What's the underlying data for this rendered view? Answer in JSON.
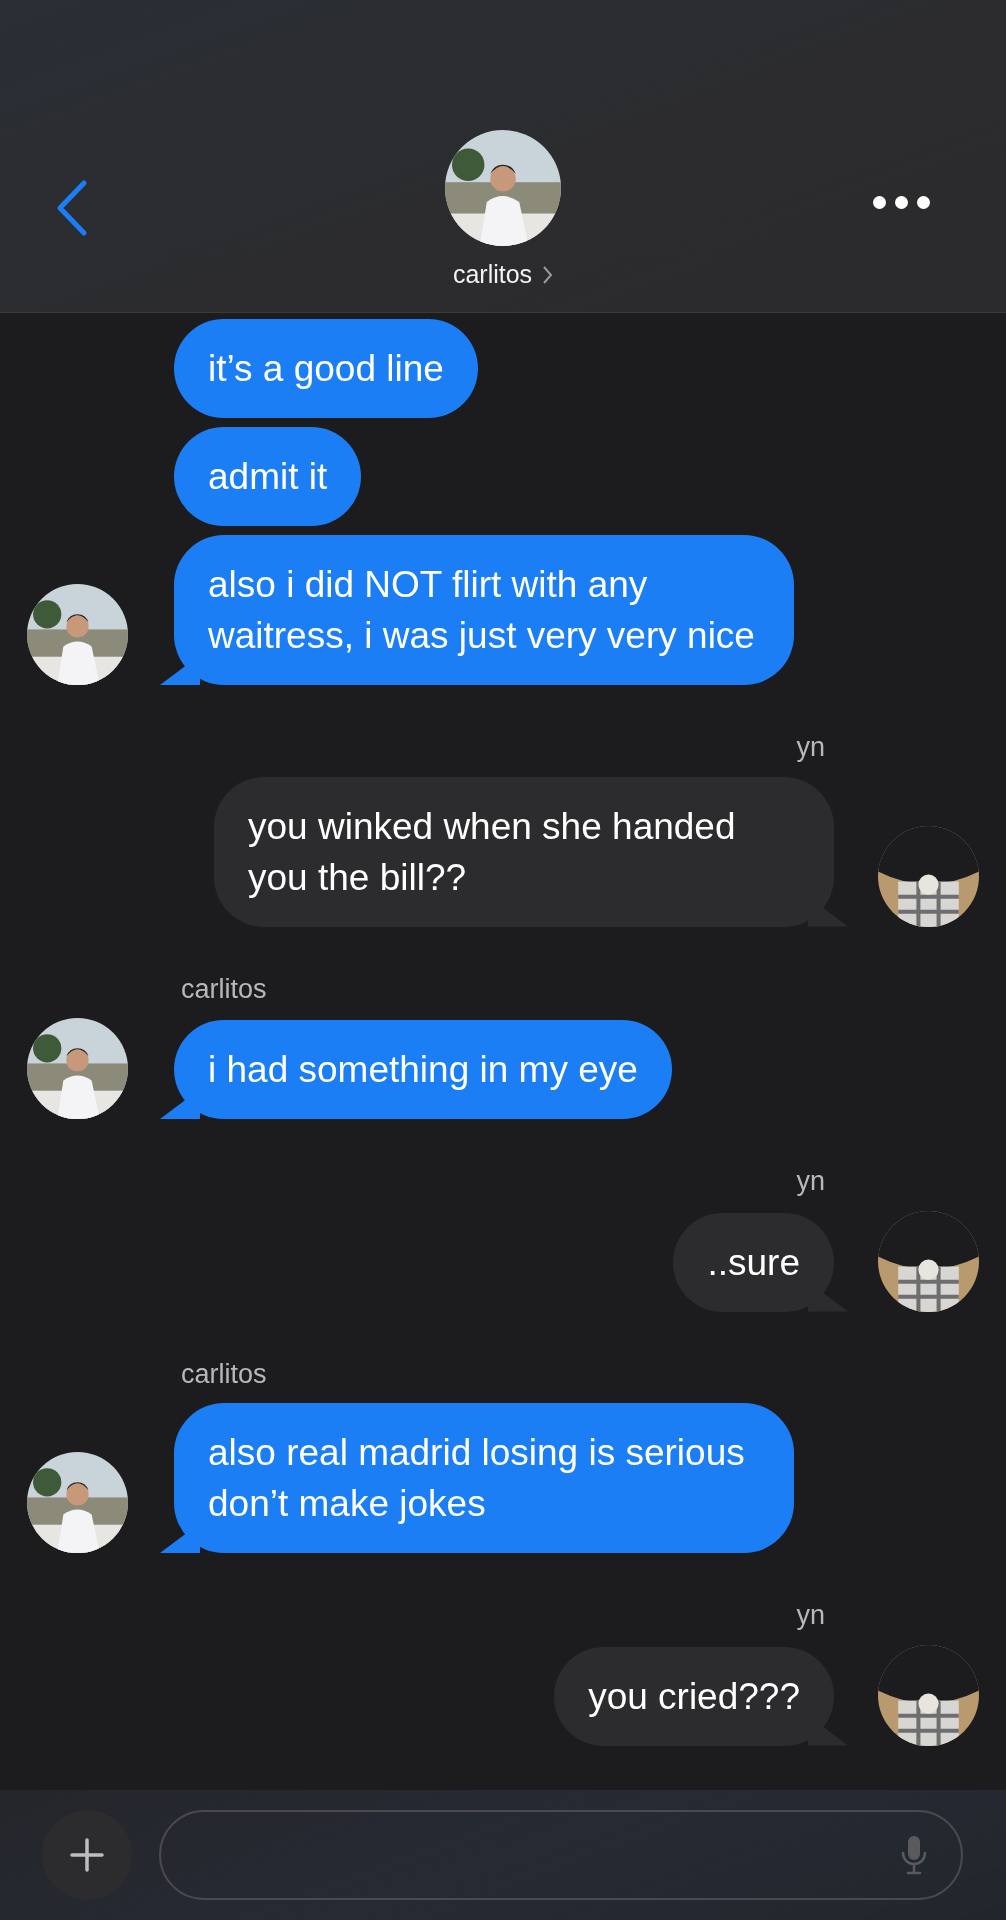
{
  "header": {
    "contact_name": "carlitos"
  },
  "messages": [
    {
      "kind": "received",
      "text": "it’s a good line",
      "avatar": false
    },
    {
      "kind": "received",
      "text": "admit it",
      "avatar": false
    },
    {
      "kind": "received",
      "text": "also i did NOT flirt with any waitress, i was just very very nice",
      "avatar": true
    },
    {
      "kind": "sent",
      "sender": "yn",
      "text": "you winked when she handed you the bill??",
      "avatar": true
    },
    {
      "kind": "received",
      "sender": "carlitos",
      "text": "i had something in my eye",
      "avatar": true
    },
    {
      "kind": "sent",
      "sender": "yn",
      "text": "..sure",
      "avatar": true
    },
    {
      "kind": "received",
      "sender": "carlitos",
      "text": "also real madrid losing is serious don’t make jokes",
      "avatar": true
    },
    {
      "kind": "sent",
      "sender": "yn",
      "text": "you cried???",
      "avatar": true
    }
  ]
}
